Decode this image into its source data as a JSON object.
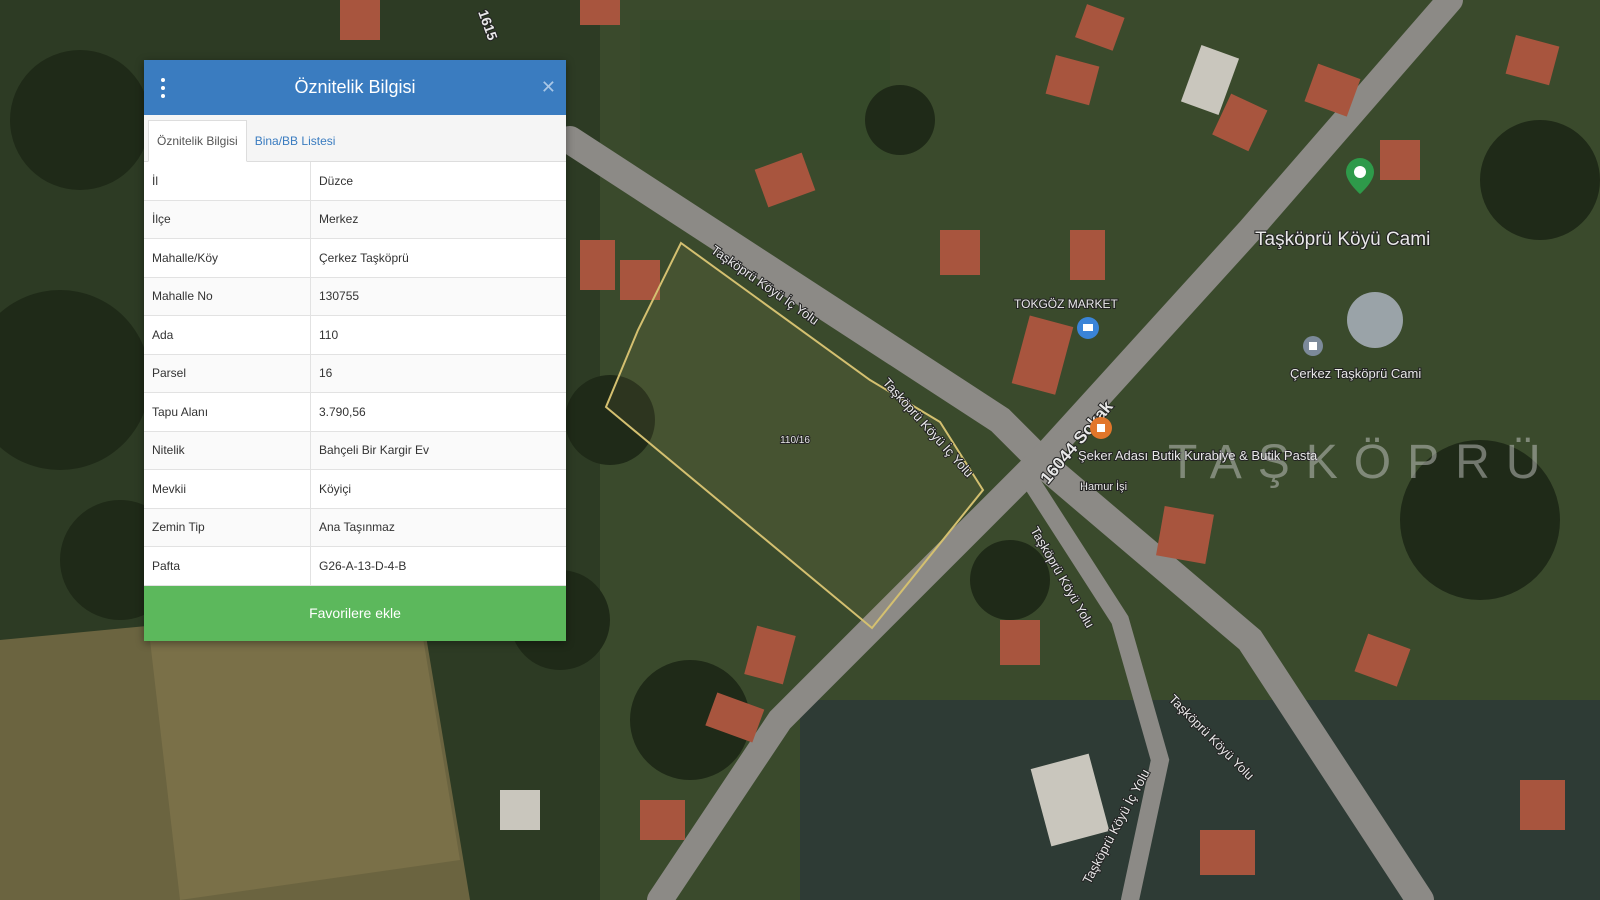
{
  "panel": {
    "title": "Öznitelik Bilgisi",
    "tabs": [
      "Öznitelik Bilgisi",
      "Bina/BB Listesi"
    ],
    "active_tab": 0,
    "rows": [
      {
        "key": "İl",
        "value": "Düzce"
      },
      {
        "key": "İlçe",
        "value": "Merkez"
      },
      {
        "key": "Mahalle/Köy",
        "value": "Çerkez Taşköprü"
      },
      {
        "key": "Mahalle No",
        "value": "130755"
      },
      {
        "key": "Ada",
        "value": "110"
      },
      {
        "key": "Parsel",
        "value": "16"
      },
      {
        "key": "Tapu Alanı",
        "value": "3.790,56"
      },
      {
        "key": "Nitelik",
        "value": "Bahçeli Bir Kargir Ev"
      },
      {
        "key": "Mevkii",
        "value": "Köyiçi"
      },
      {
        "key": "Zemin Tip",
        "value": "Ana Taşınmaz"
      },
      {
        "key": "Pafta",
        "value": "G26-A-13-D-4-B"
      }
    ],
    "favorite_label": "Favorilere ekle"
  },
  "map": {
    "parcel_label": "110/16",
    "roads": {
      "road_1": "Taşköprü Köyü İç Yolu",
      "road_2": "Taşköprü Köyü İç Yolu",
      "road_3": "16044 Sokak",
      "road_4": "Taşköprü Köyü Yolu",
      "road_5": "Taşköprü Köyü Yolu",
      "road_6": "Taşköprü Köyü İç Yolu",
      "road_7": "1615"
    },
    "places": {
      "mosque_title": "Taşköprü Köyü Cami",
      "market": "TOKGÖZ MARKET",
      "mosque_2": "Çerkez Taşköprü Cami",
      "shop": "Şeker Adası Butik Kurabiye & Butik Pasta",
      "shop_sub": "Hamur İşi",
      "village": "TAŞKÖPRÜ"
    },
    "colors": {
      "parcel": "#d4c070",
      "mosque_pin": "#2e9a4a",
      "market_pin": "#3a84d8",
      "shop_pin": "#e2762a"
    }
  }
}
